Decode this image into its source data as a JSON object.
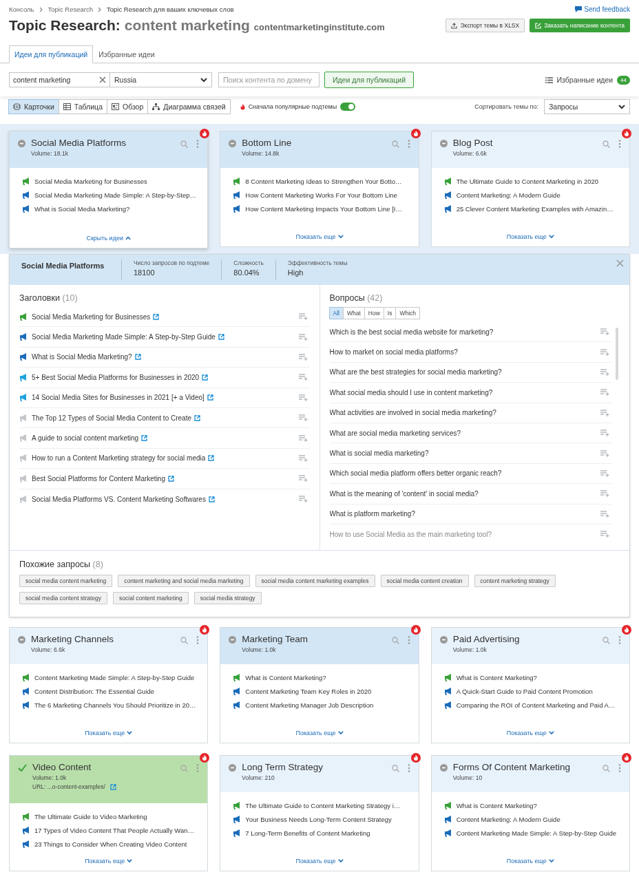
{
  "breadcrumbs": [
    "Консоль",
    "Topic Research",
    "Topic Research для ваших ключевых слов"
  ],
  "feedback": "Send feedback",
  "title": {
    "tool": "Topic Research:",
    "topic": "content marketing",
    "domain": "contentmarketinginstitute.com"
  },
  "header_buttons": [
    {
      "label": "Экспорт темы в XLSX",
      "kind": "export"
    },
    {
      "label": "Заказать написание контента",
      "kind": "order"
    }
  ],
  "tabs": [
    {
      "label": "Идеи для публикаций",
      "selected": true
    },
    {
      "label": "Избранные идеи",
      "selected": false
    }
  ],
  "search": {
    "keyword": "content marketing",
    "country": "Russia",
    "domain_placeholder": "Поиск контента по домену",
    "submit": "Идеи для публикаций",
    "favorites": "Избранные идеи",
    "favorites_count": "44"
  },
  "views": [
    {
      "label": "Карточки",
      "kind": "cards",
      "selected": true
    },
    {
      "label": "Таблица",
      "kind": "table",
      "selected": false
    },
    {
      "label": "Обзор",
      "kind": "overview",
      "selected": false
    },
    {
      "label": "Диаграмма связей",
      "kind": "mindmap",
      "selected": false
    }
  ],
  "popular_first": {
    "label": "Сначала популярные подтемы",
    "on": true
  },
  "sort": {
    "label": "Сортировать темы по:",
    "value": "Запросы"
  },
  "cards_top": [
    {
      "title": "Social Media Platforms",
      "volume_label": "Volume:",
      "volume": "18.1k",
      "highlighted": true,
      "checked": false,
      "expanded": true,
      "toggle": "Скрыть идеи",
      "ideas": [
        {
          "text": "Social Media Marketing for Businesses",
          "color": "#3aa13a"
        },
        {
          "text": "Social Media Marketing Made Simple: A Step-by-Step…",
          "color": "#1b6cb8"
        },
        {
          "text": "What is Social Media Marketing?",
          "color": "#1b6cb8"
        }
      ]
    },
    {
      "title": "Bottom Line",
      "volume_label": "Volume:",
      "volume": "14.8k",
      "highlighted": true,
      "checked": false,
      "expanded": false,
      "toggle": "Показать еще",
      "ideas": [
        {
          "text": "8 Content Marketing Ideas to Strengthen Your Botto…",
          "color": "#3aa13a"
        },
        {
          "text": "How Content Marketing Works For Your Bottom Line",
          "color": "#1b6cb8"
        },
        {
          "text": "How Content Marketing Impacts Your Bottom Line [I…",
          "color": "#1b6cb8"
        }
      ]
    },
    {
      "title": "Blog Post",
      "volume_label": "Volume:",
      "volume": "6.6k",
      "highlighted": false,
      "checked": false,
      "expanded": false,
      "toggle": "Показать еще",
      "ideas": [
        {
          "text": "The Ultimate Guide to Content Marketing in 2020",
          "color": "#3aa13a"
        },
        {
          "text": "Content Marketing: A Modern Guide",
          "color": "#1b6cb8"
        },
        {
          "text": "25 Clever Content Marketing Examples with Amazin…",
          "color": "#1b6cb8"
        }
      ]
    }
  ],
  "detail": {
    "title": "Social Media Platforms",
    "stats": [
      {
        "label": "Число запросов по подтеме",
        "value": "18100"
      },
      {
        "label": "Сложность",
        "value": "80.04%"
      },
      {
        "label": "Эффективность темы",
        "value": "High"
      }
    ],
    "headlines": {
      "title": "Заголовки",
      "count": "(10)",
      "items": [
        {
          "text": "Social Media Marketing for Businesses",
          "color": "#3aa13a"
        },
        {
          "text": "Social Media Marketing Made Simple: A Step-by-Step Guide",
          "color": "#1b6cb8"
        },
        {
          "text": "What is Social Media Marketing?",
          "color": "#1b6cb8"
        },
        {
          "text": "5+ Best Social Media Platforms for Businesses in 2020",
          "color": "#22a3dc"
        },
        {
          "text": "14 Social Media Sites for Businesses in 2021 [+ a Video]",
          "color": "#22a3dc"
        },
        {
          "text": "The Top 12 Types of Social Media Content to Create",
          "color": "#c3c7cb"
        },
        {
          "text": "A guide to social content marketing",
          "color": "#c3c7cb"
        },
        {
          "text": "How to run a Content Marketing strategy for social media",
          "color": "#c3c7cb"
        },
        {
          "text": "Best Social Platforms for Content Marketing",
          "color": "#c3c7cb"
        },
        {
          "text": "Social Media Platforms VS. Content Marketing Softwares",
          "color": "#c3c7cb"
        }
      ]
    },
    "questions": {
      "title": "Вопросы",
      "count": "(42)",
      "filters": [
        {
          "label": "All",
          "selected": true
        },
        {
          "label": "What",
          "selected": false
        },
        {
          "label": "How",
          "selected": false
        },
        {
          "label": "Is",
          "selected": false
        },
        {
          "label": "Which",
          "selected": false
        }
      ],
      "items": [
        "Which is the best social media website for marketing?",
        "How to market on social media platforms?",
        "What are the best strategies for social media marketing?",
        "What social media should I use in content marketing?",
        "What activities are involved in social media marketing?",
        "What are social media marketing services?",
        "What is social media marketing?",
        "Which social media platform offers better organic reach?",
        "What is the meaning of 'content' in social media?",
        "What is platform marketing?",
        "How to use Social Media as the main marketing tool?"
      ]
    },
    "related": {
      "title": "Похожие запросы",
      "count": "(8)",
      "items": [
        "social media content marketing",
        "content marketing and social media marketing",
        "social media content marketing examples",
        "social media content creation",
        "content marketing strategy",
        "social media content strategy",
        "social content marketing",
        "social media strategy"
      ]
    }
  },
  "cards_bottom": [
    {
      "title": "Marketing Channels",
      "volume_label": "Volume:",
      "volume": "6.6k",
      "highlighted": false,
      "checked": false,
      "expanded": false,
      "toggle": "Показать еще",
      "ideas": [
        {
          "text": "Content Marketing Made Simple: A Step-by-Step Guide",
          "color": "#3aa13a"
        },
        {
          "text": "Content Distribution: The Essential Guide",
          "color": "#1b6cb8"
        },
        {
          "text": "The 6 Marketing Channels You Should Prioritize in 20…",
          "color": "#1b6cb8"
        }
      ]
    },
    {
      "title": "Marketing Team",
      "volume_label": "Volume:",
      "volume": "1.0k",
      "highlighted": true,
      "checked": false,
      "expanded": false,
      "toggle": "Показать еще",
      "ideas": [
        {
          "text": "What is Content Marketing?",
          "color": "#3aa13a"
        },
        {
          "text": "Content Marketing Team Key Roles in 2020",
          "color": "#1b6cb8"
        },
        {
          "text": "Content Marketing Manager Job Description",
          "color": "#1b6cb8"
        }
      ]
    },
    {
      "title": "Paid Advertising",
      "volume_label": "Volume:",
      "volume": "1.0k",
      "highlighted": false,
      "checked": false,
      "expanded": false,
      "toggle": "Показать еще",
      "ideas": [
        {
          "text": "What is Content Marketing?",
          "color": "#3aa13a"
        },
        {
          "text": "A Quick-Start Guide to Paid Content Promotion",
          "color": "#1b6cb8"
        },
        {
          "text": "Comparing the ROI of Content Marketing and Paid A…",
          "color": "#1b6cb8"
        }
      ]
    },
    {
      "title": "Video Content",
      "volume_label": "Volume:",
      "volume": "1.0k",
      "url_label": "URL:",
      "url": "...o-content-examples/",
      "checked": true,
      "expanded": false,
      "toggle": "Показать еще",
      "ideas": [
        {
          "text": "The Ultimate Guide to Video Marketing",
          "color": "#3aa13a"
        },
        {
          "text": "17 Types of Video Content That People Actually Wan…",
          "color": "#1b6cb8"
        },
        {
          "text": "23 Things to Consider When Creating Video Content",
          "color": "#1b6cb8"
        }
      ]
    },
    {
      "title": "Long Term Strategy",
      "volume_label": "Volume:",
      "volume": "210",
      "highlighted": false,
      "checked": false,
      "expanded": false,
      "toggle": "Показать еще",
      "ideas": [
        {
          "text": "The Ultimate Guide to Content Marketing Strategy i…",
          "color": "#3aa13a"
        },
        {
          "text": "Your Business Needs Long-Term Content Strategy",
          "color": "#1b6cb8"
        },
        {
          "text": "7 Long-Term Benefits of Content Marketing",
          "color": "#1b6cb8"
        }
      ]
    },
    {
      "title": "Forms Of Content Marketing",
      "volume_label": "Volume:",
      "volume": "10",
      "highlighted": false,
      "checked": false,
      "expanded": false,
      "toggle": "Показать еще",
      "ideas": [
        {
          "text": "What is Content Marketing?",
          "color": "#3aa13a"
        },
        {
          "text": "Content Marketing: A Modern Guide",
          "color": "#1b6cb8"
        },
        {
          "text": "Content Marketing Made Simple: A Step-by-Step Guide",
          "color": "#1b6cb8"
        }
      ]
    }
  ]
}
